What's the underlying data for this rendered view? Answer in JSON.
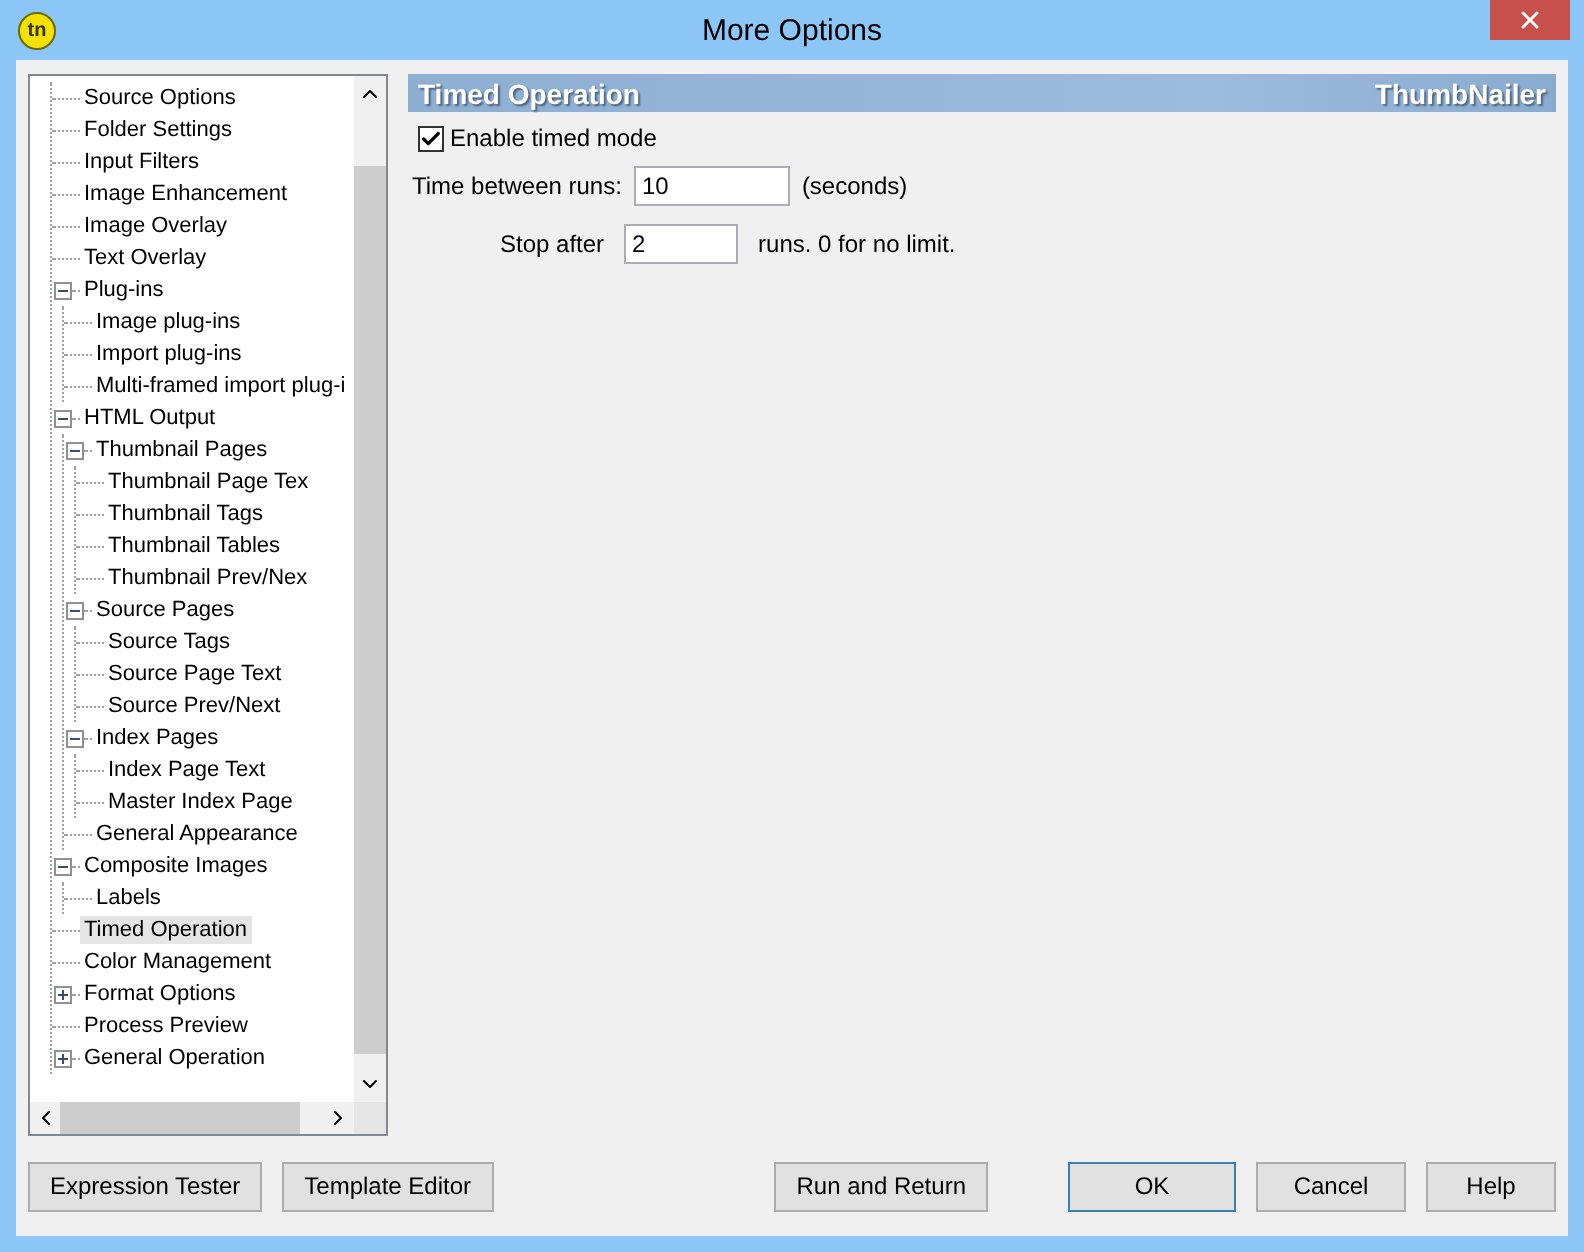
{
  "window": {
    "title": "More Options",
    "logo": "tn"
  },
  "tree": [
    {
      "label": "Source Options",
      "selected": false
    },
    {
      "label": "Folder Settings",
      "selected": false
    },
    {
      "label": "Input Filters",
      "selected": false
    },
    {
      "label": "Image Enhancement",
      "selected": false
    },
    {
      "label": "Image Overlay",
      "selected": false
    },
    {
      "label": "Text Overlay",
      "selected": false
    },
    {
      "label": "Plug-ins",
      "selected": false,
      "expanded": true,
      "children": [
        {
          "label": "Image plug-ins",
          "selected": false
        },
        {
          "label": "Import plug-ins",
          "selected": false
        },
        {
          "label": "Multi-framed import plug-i",
          "selected": false
        }
      ]
    },
    {
      "label": "HTML Output",
      "selected": false,
      "expanded": true,
      "children": [
        {
          "label": "Thumbnail Pages",
          "selected": false,
          "expanded": true,
          "children": [
            {
              "label": "Thumbnail Page Tex",
              "selected": false
            },
            {
              "label": "Thumbnail Tags",
              "selected": false
            },
            {
              "label": "Thumbnail Tables",
              "selected": false
            },
            {
              "label": "Thumbnail Prev/Nex",
              "selected": false
            }
          ]
        },
        {
          "label": "Source Pages",
          "selected": false,
          "expanded": true,
          "children": [
            {
              "label": "Source Tags",
              "selected": false
            },
            {
              "label": "Source Page Text",
              "selected": false
            },
            {
              "label": "Source Prev/Next",
              "selected": false
            }
          ]
        },
        {
          "label": "Index Pages",
          "selected": false,
          "expanded": true,
          "children": [
            {
              "label": "Index Page Text",
              "selected": false
            },
            {
              "label": "Master Index Page",
              "selected": false
            }
          ]
        },
        {
          "label": "General Appearance",
          "selected": false
        }
      ]
    },
    {
      "label": "Composite Images",
      "selected": false,
      "expanded": true,
      "children": [
        {
          "label": "Labels",
          "selected": false
        }
      ]
    },
    {
      "label": "Timed Operation",
      "selected": true
    },
    {
      "label": "Color Management",
      "selected": false
    },
    {
      "label": "Format Options",
      "selected": false,
      "expanded": false
    },
    {
      "label": "Process Preview",
      "selected": false
    },
    {
      "label": "General Operation",
      "selected": false,
      "expanded": false
    }
  ],
  "panel": {
    "title": "Timed Operation",
    "brand": "ThumbNailer",
    "enable": {
      "label": "Enable timed mode",
      "checked": true
    },
    "interval": {
      "label": "Time between runs:",
      "value": "10",
      "unit": "(seconds)"
    },
    "stop": {
      "label": "Stop after",
      "value": "2",
      "unit": "runs. 0 for no limit."
    }
  },
  "buttons_left": [
    "Expression Tester",
    "Template Editor"
  ],
  "button_middle": "Run and Return",
  "buttons_right": [
    {
      "label": "OK",
      "default": true
    },
    {
      "label": "Cancel",
      "default": false
    },
    {
      "label": "Help",
      "default": false
    }
  ]
}
